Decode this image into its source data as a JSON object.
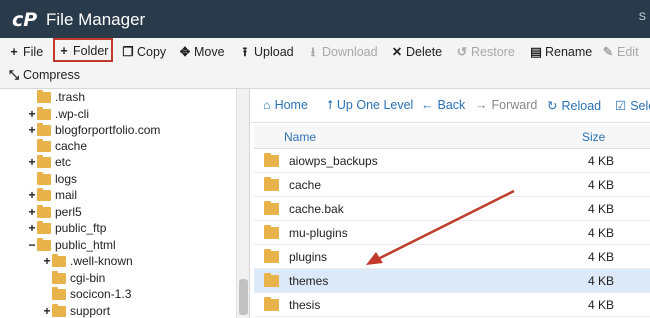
{
  "header": {
    "title": "File Manager",
    "corner_text": "S"
  },
  "toolbar": {
    "file": "File",
    "folder": "Folder",
    "copy": "Copy",
    "move": "Move",
    "upload": "Upload",
    "download": "Download",
    "delete": "Delete",
    "restore": "Restore",
    "rename": "Rename",
    "edit": "Edit",
    "compress": "Compress"
  },
  "tree": {
    "items": [
      {
        "label": ".trash",
        "expander": ""
      },
      {
        "label": ".wp-cli",
        "expander": "+"
      },
      {
        "label": "blogforportfolio.com",
        "expander": "+"
      },
      {
        "label": "cache",
        "expander": ""
      },
      {
        "label": "etc",
        "expander": "+"
      },
      {
        "label": "logs",
        "expander": ""
      },
      {
        "label": "mail",
        "expander": "+"
      },
      {
        "label": "perl5",
        "expander": "+"
      },
      {
        "label": "public_ftp",
        "expander": "+"
      },
      {
        "label": "public_html",
        "expander": "−"
      },
      {
        "label": ".well-known",
        "expander": "+"
      },
      {
        "label": "cgi-bin",
        "expander": ""
      },
      {
        "label": "socicon-1.3",
        "expander": ""
      },
      {
        "label": "support",
        "expander": "+"
      }
    ]
  },
  "navbar": {
    "home": "Home",
    "up_one_level": "Up One Level",
    "back": "Back",
    "forward": "Forward",
    "reload": "Reload",
    "select": "Sele"
  },
  "table": {
    "col_name": "Name",
    "col_size": "Size",
    "rows": [
      {
        "name": "aiowps_backups",
        "size": "4 KB"
      },
      {
        "name": "cache",
        "size": "4 KB"
      },
      {
        "name": "cache.bak",
        "size": "4 KB"
      },
      {
        "name": "mu-plugins",
        "size": "4 KB"
      },
      {
        "name": "plugins",
        "size": "4 KB"
      },
      {
        "name": "themes",
        "size": "4 KB",
        "selected": true
      },
      {
        "name": "thesis",
        "size": "4 KB"
      }
    ]
  },
  "colors": {
    "header_bg": "#293a4a",
    "highlight_box": "#c0392b",
    "arrow": "#c0392b",
    "folder": "#e9b34c",
    "link": "#2b72b5",
    "selected_row": "#dbe9f8"
  },
  "icons": {
    "logo": "cpanel-logo",
    "folder": "folder-icon",
    "arrow": "red-annotation-arrow"
  }
}
